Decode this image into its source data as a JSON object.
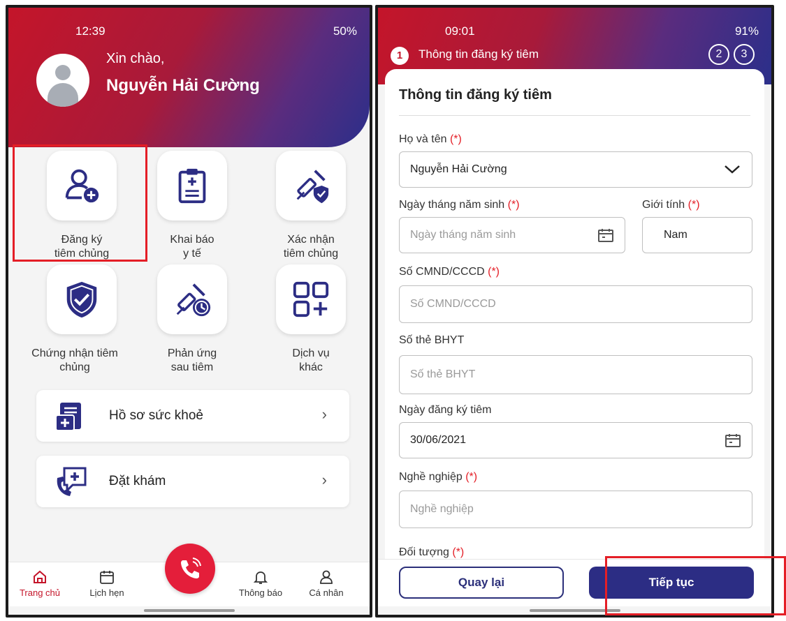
{
  "left": {
    "status": {
      "time": "12:39",
      "right": "50%"
    },
    "greeting": "Xin chào,",
    "username": "Nguyễn Hải Cường",
    "grid": [
      {
        "line1": "Đăng ký",
        "line2": "tiêm chủng",
        "icon": "add-user-icon"
      },
      {
        "line1": "Khai báo",
        "line2": "y tế",
        "icon": "clipboard-icon"
      },
      {
        "line1": "Xác nhận",
        "line2": "tiêm chủng",
        "icon": "vaccine-shield-icon"
      },
      {
        "line1": "Chứng nhận tiêm",
        "line2": "chủng",
        "icon": "shield-check-icon"
      },
      {
        "line1": "Phản ứng",
        "line2": "sau tiêm",
        "icon": "vaccine-clock-icon"
      },
      {
        "line1": "Dịch vụ",
        "line2": "khác",
        "icon": "grid-plus-icon"
      }
    ],
    "menu": [
      {
        "label": "Hồ sơ sức khoẻ",
        "icon": "health-record-icon"
      },
      {
        "label": "Đặt khám",
        "icon": "booking-icon"
      }
    ],
    "nav": [
      {
        "label": "Trang chủ",
        "icon": "home-icon"
      },
      {
        "label": "Lịch hẹn",
        "icon": "calendar-icon"
      },
      {
        "label": "Thông báo",
        "icon": "bell-icon"
      },
      {
        "label": "Cá nhân",
        "icon": "person-icon"
      }
    ],
    "accent": "#c4152a"
  },
  "right": {
    "status": {
      "time": "09:01",
      "right": "91%"
    },
    "step": {
      "current": "1",
      "title": "Thông tin đăng ký tiêm",
      "s2": "2",
      "s3": "3"
    },
    "form_title": "Thông tin đăng ký tiêm",
    "required_mark": "(*)",
    "fields": {
      "name": {
        "label": "Họ và tên",
        "value": "Nguyễn Hải Cường"
      },
      "dob": {
        "label": "Ngày tháng năm sinh",
        "placeholder": "Ngày tháng năm sinh"
      },
      "gender": {
        "label": "Giới tính",
        "value": "Nam"
      },
      "idcard": {
        "label": "Số CMND/CCCD",
        "placeholder": "Số CMND/CCCD"
      },
      "insurance": {
        "label": "Số thẻ BHYT",
        "placeholder": "Số thẻ BHYT"
      },
      "regdate": {
        "label": "Ngày đăng ký tiêm",
        "value": "30/06/2021"
      },
      "job": {
        "label": "Nghề nghiệp",
        "placeholder": "Nghề nghiệp"
      },
      "target": {
        "label": "Đối tượng"
      }
    },
    "buttons": {
      "back": "Quay lại",
      "next": "Tiếp tục"
    },
    "button_color": "#2c2d84"
  }
}
